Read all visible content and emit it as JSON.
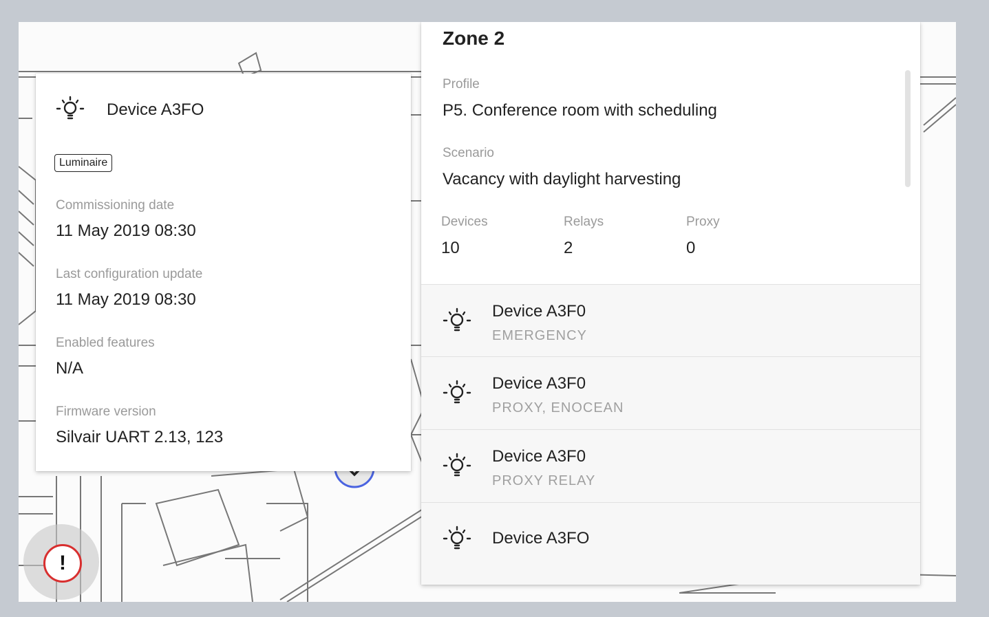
{
  "device_card": {
    "title": "Device A3FO",
    "badge": "Luminaire",
    "fields": [
      {
        "label": "Commissioning date",
        "value": "11 May 2019   08:30"
      },
      {
        "label": "Last configuration update",
        "value": "11 May 2019   08:30"
      },
      {
        "label": "Enabled features",
        "value": "N/A"
      },
      {
        "label": "Firmware version",
        "value": "Silvair UART 2.13, 123"
      }
    ]
  },
  "zone": {
    "title": "Zone 2",
    "profile_label": "Profile",
    "profile_value": "P5. Conference room with scheduling",
    "scenario_label": "Scenario",
    "scenario_value": "Vacancy with daylight harvesting",
    "stats": [
      {
        "label": "Devices",
        "value": "10"
      },
      {
        "label": "Relays",
        "value": "2"
      },
      {
        "label": "Proxy",
        "value": "0"
      }
    ],
    "devices": [
      {
        "name": "Device A3F0",
        "features": "EMERGENCY"
      },
      {
        "name": "Device A3F0",
        "features": "PROXY, ENOCEAN"
      },
      {
        "name": "Device A3F0",
        "features": "PROXY  RELAY"
      },
      {
        "name": "Device A3FO",
        "features": ""
      }
    ]
  },
  "icons": {
    "device": "lightbulb-icon",
    "alert": "exclamation-alert-icon"
  },
  "alert_symbol": "!",
  "colors": {
    "alert": "#d82f2f",
    "selection_ring": "#4a63e0",
    "background": "#c5cad1"
  }
}
